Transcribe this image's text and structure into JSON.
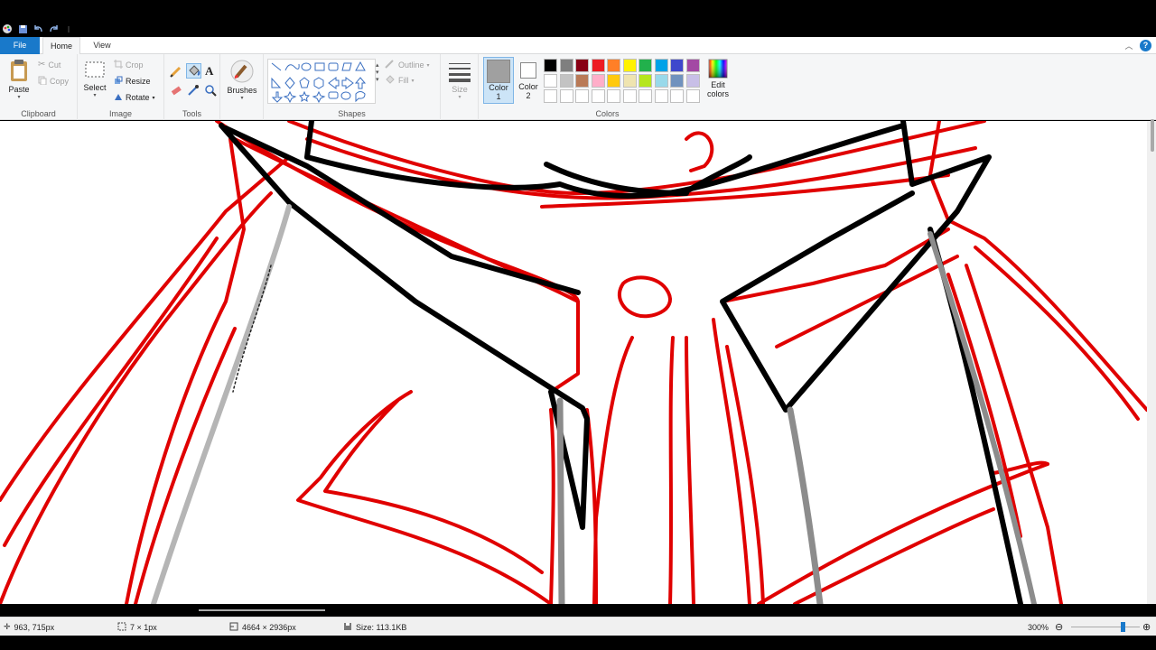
{
  "titlebar": {
    "qat_icons": [
      "paint-icon",
      "save-icon",
      "undo-icon",
      "redo-icon",
      "customize-qat-icon"
    ]
  },
  "tabs": {
    "file": "File",
    "home": "Home",
    "view": "View"
  },
  "ribbon": {
    "clipboard": {
      "label": "Clipboard",
      "paste": "Paste",
      "cut": "Cut",
      "copy": "Copy"
    },
    "image": {
      "label": "Image",
      "select": "Select",
      "crop": "Crop",
      "resize": "Resize",
      "rotate": "Rotate"
    },
    "tools": {
      "label": "Tools"
    },
    "brushes": {
      "label": "Brushes"
    },
    "shapes": {
      "label": "Shapes",
      "outline": "Outline",
      "fill": "Fill"
    },
    "size": {
      "label": "Size"
    },
    "color1": {
      "label_line1": "Color",
      "label_line2": "1",
      "value": "#a0a0a0"
    },
    "color2": {
      "label_line1": "Color",
      "label_line2": "2",
      "value": "#ffffff"
    },
    "colors": {
      "label": "Colors",
      "palette_row1": [
        "#000000",
        "#7f7f7f",
        "#880015",
        "#ed1c24",
        "#ff7f27",
        "#fff200",
        "#22b14c",
        "#00a2e8",
        "#3f48cc",
        "#a349a4"
      ],
      "palette_row2": [
        "#ffffff",
        "#c3c3c3",
        "#b97a57",
        "#ffaec9",
        "#ffc90e",
        "#efe4b0",
        "#b5e61d",
        "#99d9ea",
        "#7092be",
        "#c8bfe7"
      ],
      "palette_row3": [
        "#ffffff",
        "#ffffff",
        "#ffffff",
        "#ffffff",
        "#ffffff",
        "#ffffff",
        "#ffffff",
        "#ffffff",
        "#ffffff",
        "#ffffff"
      ],
      "edit_line1": "Edit",
      "edit_line2": "colors"
    }
  },
  "status": {
    "cursor_pos": "963, 715px",
    "selection_size": "7 × 1px",
    "image_size": "4664 × 2936px",
    "file_size": "Size: 113.1KB",
    "zoom": "300%",
    "zoom_level": 0.78
  },
  "colors": {
    "accent": "#1979ca",
    "ribbon_bg": "#f5f6f7",
    "sketch_red": "#e00000",
    "sketch_black": "#000000",
    "sketch_gray": "#9a9a9a"
  }
}
